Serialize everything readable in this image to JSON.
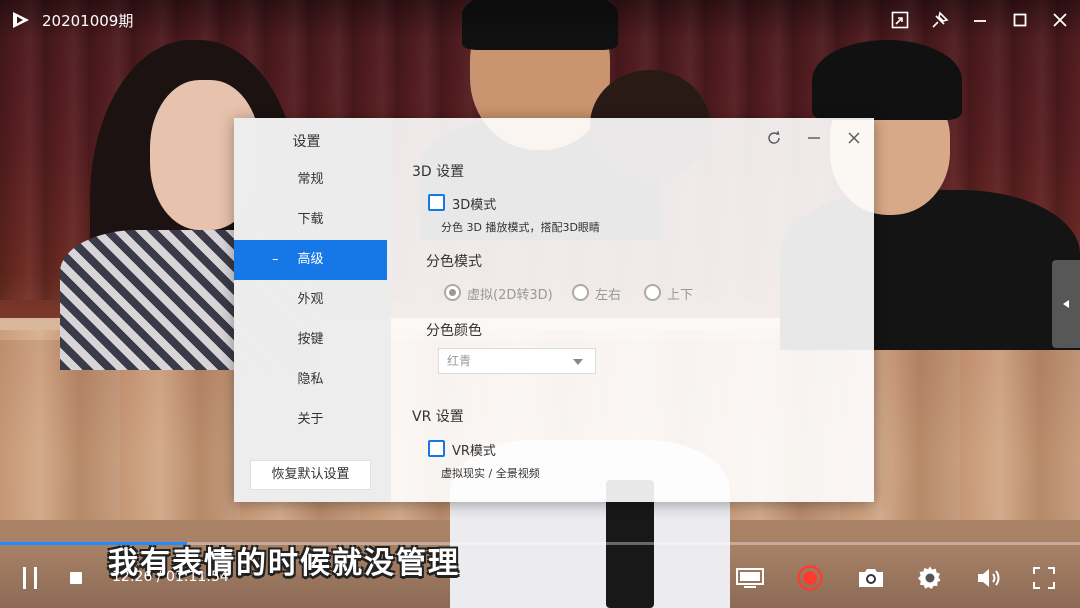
{
  "window": {
    "title": "20201009期"
  },
  "dialog": {
    "nav_heading": "设置",
    "nav_items": [
      "常规",
      "下载",
      "高级",
      "外观",
      "按键",
      "隐私",
      "关于"
    ],
    "active_index": 2,
    "active_prefix": "–",
    "restore_label": "恢复默认设置",
    "section_3d": {
      "title": "3D 设置",
      "checkbox_label": "3D模式",
      "checkbox_checked": false,
      "description": "分色 3D 播放模式，搭配3D眼睛",
      "color_mode_title": "分色模式",
      "color_mode_options": [
        "虚拟(2D转3D)",
        "左右",
        "上下"
      ],
      "color_mode_selected": 0,
      "color_title": "分色颜色",
      "color_value": "红青"
    },
    "section_vr": {
      "title": "VR 设置",
      "checkbox_label": "VR模式",
      "checkbox_checked": false,
      "description": "虚拟现实 / 全景视频"
    }
  },
  "player": {
    "subtitle": "我有表情的时候就没管理",
    "timecode": "12:26 / 01:11:54",
    "progress_fraction": 0.173,
    "accent_color": "#1f8cff",
    "record_color": "#ff3b30"
  },
  "icons": {
    "top": [
      "logo-play-icon",
      "mini-screen-icon",
      "pin-icon",
      "minimize-icon",
      "maximize-icon",
      "close-icon"
    ],
    "bottom": [
      "pause-icon",
      "stop-icon",
      "screen-icon",
      "record-icon",
      "camera-icon",
      "settings-icon",
      "volume-icon",
      "fullscreen-icon"
    ]
  }
}
